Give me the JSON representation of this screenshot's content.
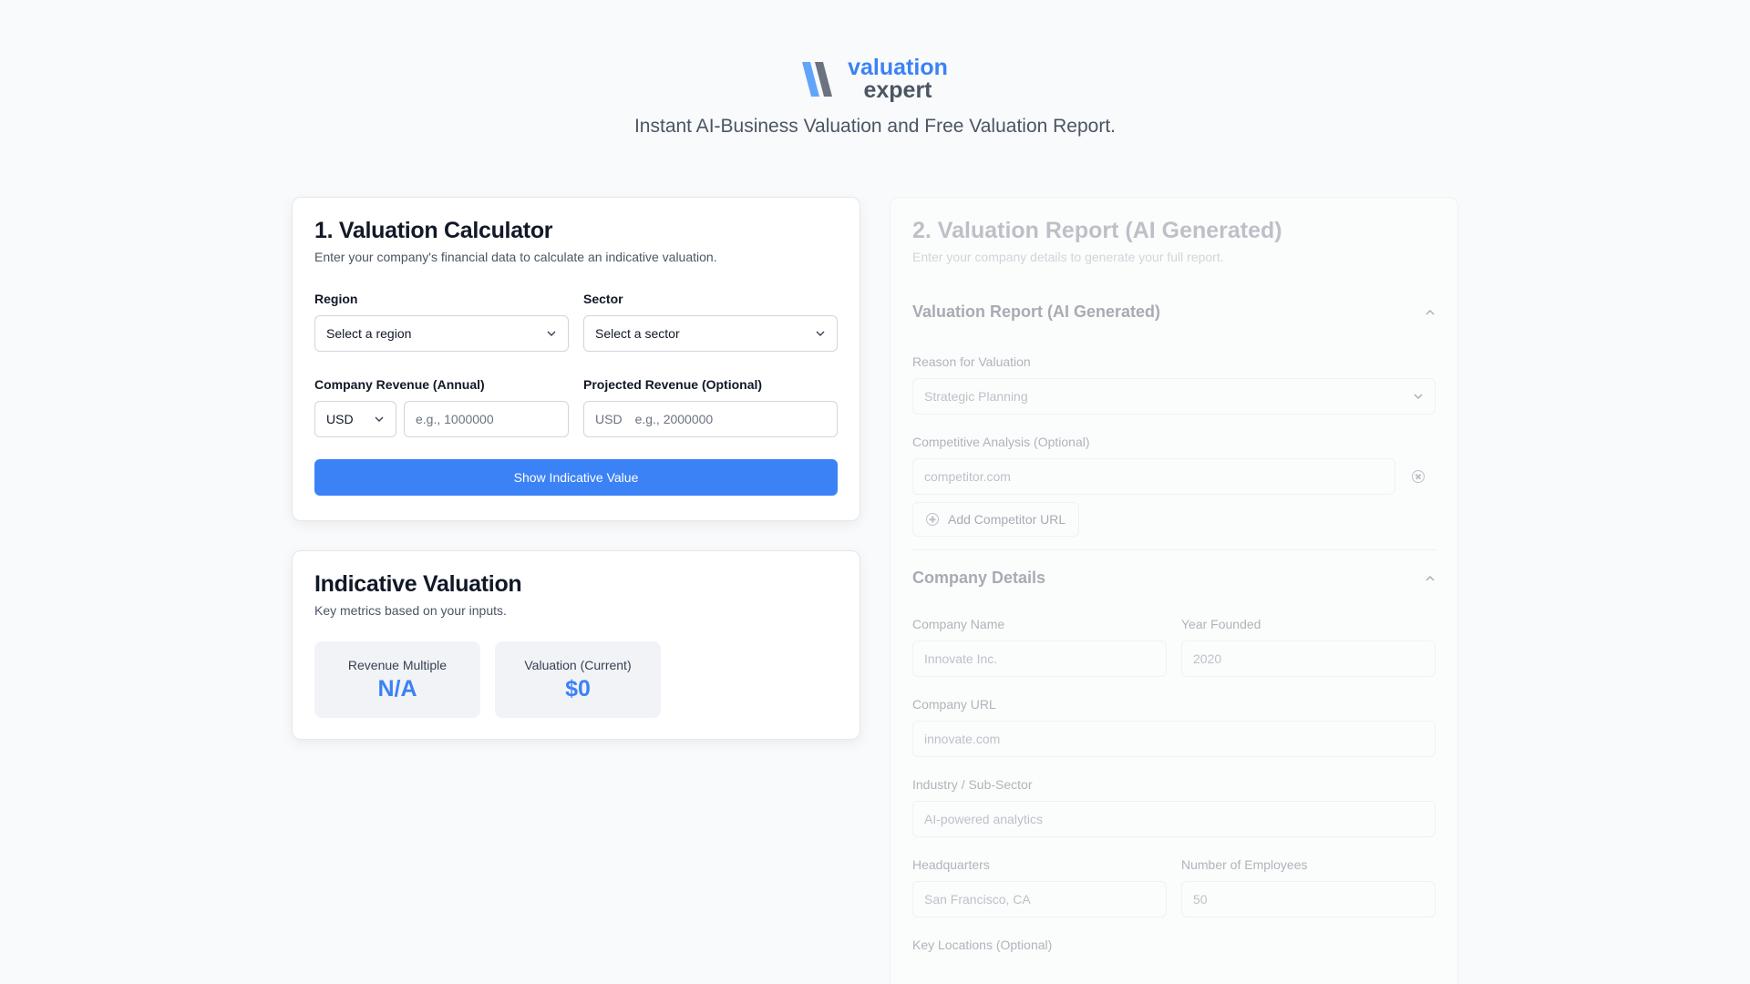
{
  "brand": {
    "word1": "valuation",
    "word2": "expert",
    "tagline": "Instant AI-Business Valuation and Free Valuation Report.",
    "colors": {
      "accent": "#3b82f6",
      "mark_light": "#60a5fa",
      "mark_gray": "#6b7280"
    }
  },
  "calculator": {
    "title": "1. Valuation Calculator",
    "subtitle": "Enter your company's financial data to calculate an indicative valuation.",
    "region": {
      "label": "Region",
      "value": "Select a region"
    },
    "sector": {
      "label": "Sector",
      "value": "Select a sector"
    },
    "revenue": {
      "label": "Company Revenue (Annual)",
      "currency": "USD",
      "placeholder": "e.g., 1000000"
    },
    "projected": {
      "label": "Projected Revenue (Optional)",
      "currency": "USD",
      "placeholder": "e.g., 2000000"
    },
    "button": "Show Indicative Value"
  },
  "indicative": {
    "title": "Indicative Valuation",
    "subtitle": "Key metrics based on your inputs.",
    "metrics": [
      {
        "label": "Revenue Multiple",
        "value": "N/A"
      },
      {
        "label": "Valuation (Current)",
        "value": "$0"
      }
    ]
  },
  "report": {
    "title": "2. Valuation Report (AI Generated)",
    "subtitle": "Enter your company details to generate your full report.",
    "section1": {
      "title": "Valuation Report (AI Generated)",
      "reason": {
        "label": "Reason for Valuation",
        "value": "Strategic Planning"
      },
      "competitive": {
        "label": "Competitive Analysis (Optional)",
        "placeholder": "competitor.com"
      },
      "add_button": "Add Competitor URL"
    },
    "section2": {
      "title": "Company Details",
      "company_name": {
        "label": "Company Name",
        "placeholder": "Innovate Inc."
      },
      "year_founded": {
        "label": "Year Founded",
        "placeholder": "2020"
      },
      "company_url": {
        "label": "Company URL",
        "placeholder": "innovate.com"
      },
      "industry": {
        "label": "Industry / Sub-Sector",
        "placeholder": "AI-powered analytics"
      },
      "headquarters": {
        "label": "Headquarters",
        "placeholder": "San Francisco, CA"
      },
      "employees": {
        "label": "Number of Employees",
        "placeholder": "50"
      },
      "key_locations": {
        "label": "Key Locations (Optional)"
      }
    }
  }
}
